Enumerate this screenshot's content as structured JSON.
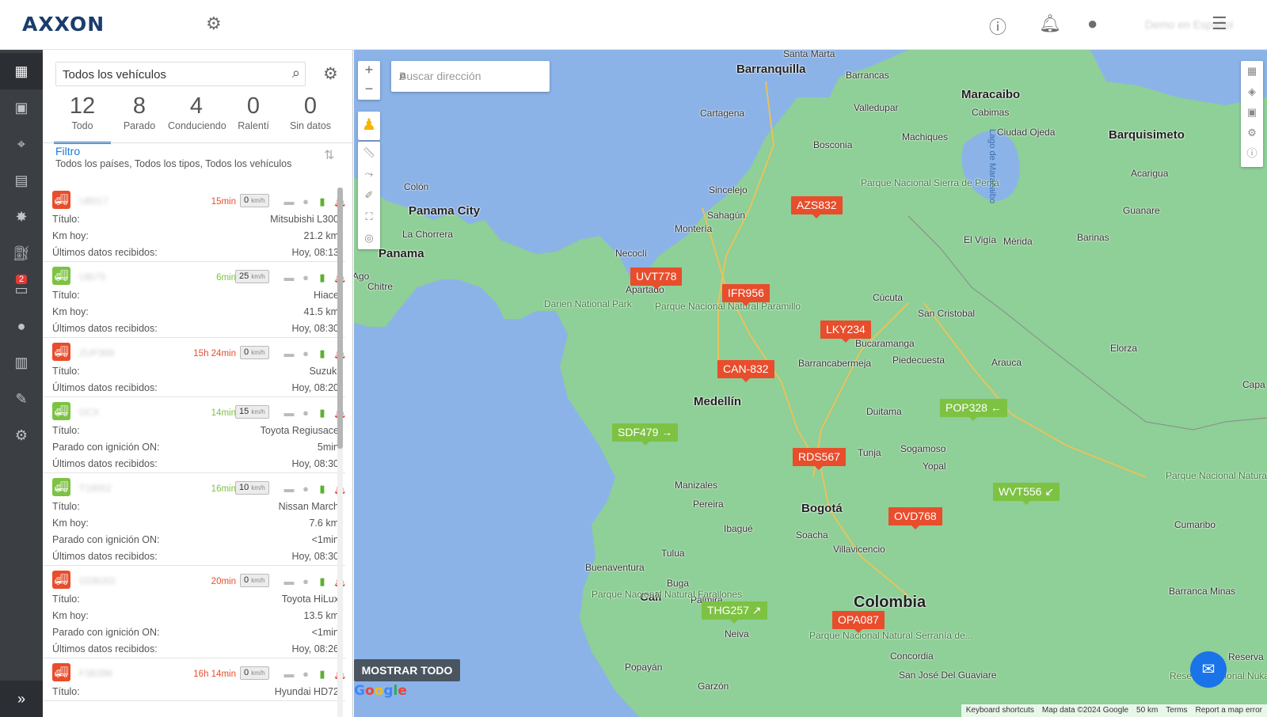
{
  "header": {
    "logo": "AXXON",
    "user": "Demo en Español"
  },
  "nav": {
    "badge": "2"
  },
  "panel": {
    "search_value": "Todos los vehículos",
    "counts": [
      {
        "n": "12",
        "label": "Todo"
      },
      {
        "n": "8",
        "label": "Parado"
      },
      {
        "n": "4",
        "label": "Conduciendo"
      },
      {
        "n": "0",
        "label": "Ralentí"
      },
      {
        "n": "0",
        "label": "Sin datos"
      }
    ],
    "filter_title": "Filtro",
    "filter_desc": "Todos los países, Todos los tipos, Todos los vehículos"
  },
  "vehicles": [
    {
      "plate": "UB017",
      "status": "red",
      "time": "15min",
      "speed": "0",
      "unit": "km/h",
      "rows": [
        [
          "Título:",
          "Mitsubishi L300"
        ],
        [
          "Km hoy:",
          "21.2 km"
        ],
        [
          "Últimos datos recibidos:",
          "Hoy, 08:13"
        ]
      ]
    },
    {
      "plate": "UBI75",
      "status": "green",
      "time": "6min",
      "speed": "25",
      "unit": "km/h",
      "rows": [
        [
          "Título:",
          "Hiace"
        ],
        [
          "Km hoy:",
          "41.5 km"
        ],
        [
          "Últimos datos recibidos:",
          "Hoy, 08:30"
        ]
      ]
    },
    {
      "plate": "ZUP368",
      "status": "red",
      "time": "15h 24min",
      "speed": "0",
      "unit": "km/h",
      "rows": [
        [
          "Título:",
          "Suzuki"
        ],
        [
          "Últimos datos recibidos:",
          "Hoy, 08:20"
        ]
      ]
    },
    {
      "plate": "DCX",
      "status": "green",
      "time": "14min",
      "speed": "15",
      "unit": "km/h",
      "rows": [
        [
          "Título:",
          "Toyota Regiusace"
        ],
        [
          "Parado con ignición ON:",
          "5min"
        ],
        [
          "Últimos datos recibidos:",
          "Hoy, 08:30"
        ]
      ]
    },
    {
      "plate": "T19052",
      "status": "green",
      "time": "16min",
      "speed": "10",
      "unit": "km/h",
      "rows": [
        [
          "Título:",
          "Nissan March"
        ],
        [
          "Km hoy:",
          "7.6 km"
        ],
        [
          "Parado con ignición ON:",
          "<1min"
        ],
        [
          "Últimos datos recibidos:",
          "Hoy, 08:30"
        ]
      ]
    },
    {
      "plate": "GDB202",
      "status": "red",
      "time": "20min",
      "speed": "0",
      "unit": "km/h",
      "rows": [
        [
          "Título:",
          "Toyota HiLux"
        ],
        [
          "Km hoy:",
          "13.5 km"
        ],
        [
          "Parado con ignición ON:",
          "<1min"
        ],
        [
          "Últimos datos recibidos:",
          "Hoy, 08:26"
        ]
      ]
    },
    {
      "plate": "F3B396",
      "status": "red",
      "time": "16h 14min",
      "speed": "0",
      "unit": "km/h",
      "rows": [
        [
          "Título:",
          "Hyundai HD72"
        ]
      ]
    }
  ],
  "map": {
    "search_placeholder": "Buscar dirección",
    "show_all": "MOSTRAR TODO",
    "google": "Google",
    "attribution": [
      "Keyboard shortcuts",
      "Map data ©2024 Google",
      "50 km",
      "Terms",
      "Report a map error"
    ],
    "markers": [
      {
        "label": "AZS832",
        "color": "red"
      },
      {
        "label": "UVT778",
        "color": "red"
      },
      {
        "label": "IFR956",
        "color": "red"
      },
      {
        "label": "LKY234",
        "color": "red"
      },
      {
        "label": "CAN-832",
        "color": "red"
      },
      {
        "label": "POP328 ←",
        "color": "green"
      },
      {
        "label": "SDF479 →",
        "color": "green"
      },
      {
        "label": "RDS567",
        "color": "red"
      },
      {
        "label": "WVT556 ↙",
        "color": "green"
      },
      {
        "label": "OVD768",
        "color": "red"
      },
      {
        "label": "THG257 ↗",
        "color": "green"
      },
      {
        "label": "OPA087",
        "color": "red"
      }
    ],
    "places": [
      "Barranquilla",
      "Santa Marta",
      "Barrancas",
      "Valledupar",
      "Maracaibo",
      "Cabimas",
      "Barquisimeto",
      "Cartagena",
      "Ciudad Ojeda",
      "Machiques",
      "Colón",
      "Panama City",
      "La Chorrera",
      "Panama",
      "Sincelejo",
      "Sahagún",
      "Montería",
      "Bosconia",
      "Parque Nacional Sierra de Perijá",
      "Lago de Maracaibo",
      "Mérida",
      "Barinas",
      "El Vigía",
      "Acarigua",
      "Guanare",
      "Necoclí",
      "Apartado",
      "Chitre",
      "Darien National Park",
      "Parque Nacional Natural Paramillo",
      "Cúcuta",
      "San Cristobal",
      "Bucaramanga",
      "Barrancabermeja",
      "Piedecuesta",
      "Arauca",
      "Elorza",
      "Medellín",
      "Duitama",
      "Sogamoso",
      "Yopal",
      "Tunja",
      "Manizales",
      "Pereira",
      "Ibagué",
      "Bogotá",
      "Soacha",
      "Villavicencio",
      "Tulua",
      "Buenaventura",
      "Cali",
      "Palmira",
      "Colombia",
      "Neiva",
      "Popayán",
      "Garzón",
      "San José Del Guaviare",
      "Concordia",
      "Parque Nacional Natural Farallones",
      "Parque Nacional Natural Serranía de...",
      "Parque Nacional Natural El Tuparro",
      "Cumaribo",
      "Reserva Nacional Nukak",
      "Barranca Minas",
      "Reserva",
      "Capa",
      "Ago",
      "Buga"
    ]
  },
  "colors": {
    "red": "#e84d2c",
    "green": "#7dc243",
    "accent": "#1a7bd6",
    "nav": "#3b3f44"
  }
}
